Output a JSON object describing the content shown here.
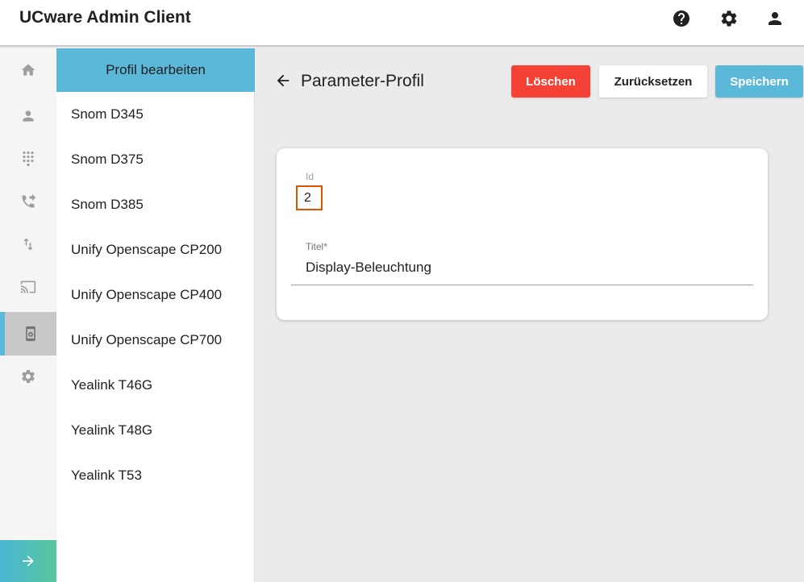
{
  "app": {
    "title": "UCware Admin Client"
  },
  "header_icons": [
    "help-icon",
    "gear-icon",
    "user-icon"
  ],
  "rail": {
    "items": [
      {
        "name": "home-icon",
        "active": false
      },
      {
        "name": "user-icon",
        "active": false
      },
      {
        "name": "dialpad-icon",
        "active": false
      },
      {
        "name": "phone-forward-icon",
        "active": false
      },
      {
        "name": "swap-vertical-icon",
        "active": false
      },
      {
        "name": "cast-icon",
        "active": false
      },
      {
        "name": "device-settings-icon",
        "active": true
      },
      {
        "name": "gear-icon",
        "active": false
      }
    ],
    "expand_icon": "arrow-right-icon"
  },
  "profile_list": {
    "header": "Profil bearbeiten",
    "items": [
      "Snom D345",
      "Snom D375",
      "Snom D385",
      "Unify Openscape CP200",
      "Unify Openscape CP400",
      "Unify Openscape CP700",
      "Yealink T46G",
      "Yealink T48G",
      "Yealink T53"
    ]
  },
  "main": {
    "title": "Parameter-Profil",
    "back_icon": "arrow-left-icon",
    "buttons": {
      "delete": "Löschen",
      "reset": "Zurücksetzen",
      "save": "Speichern"
    },
    "form": {
      "id_label": "Id",
      "id_value": "2",
      "title_label": "Titel*",
      "title_value": "Display-Beleuchtung"
    }
  },
  "colors": {
    "accent": "#5cb8d8",
    "danger": "#f44336",
    "highlight_border": "#e65100",
    "expand_gradient_end": "#58c69a"
  }
}
